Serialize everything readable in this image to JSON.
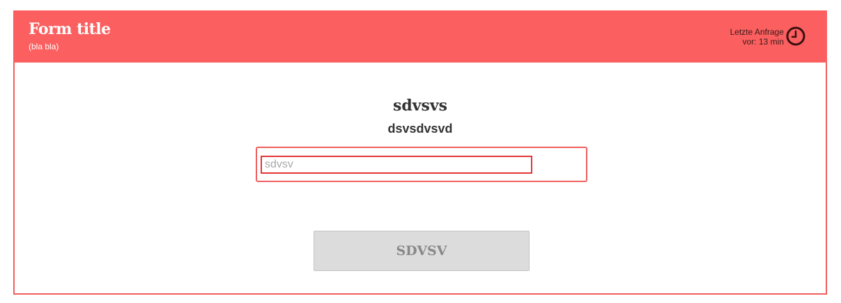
{
  "header": {
    "title": "Form title",
    "subtitle": "(bla bla)",
    "last_request_line1": "Letzte Anfrage",
    "last_request_line2": "vor: 13 min",
    "clock_icon": "clock-icon"
  },
  "question": {
    "title": "sdvsvs",
    "subtitle": "dsvsdvsvd"
  },
  "input": {
    "value": "",
    "placeholder": "sdvsv"
  },
  "submit": {
    "label": "SDVSV"
  },
  "colors": {
    "accent": "#fb5f5f",
    "border": "#f05d5d",
    "input_focus_border": "#e33535",
    "button_bg": "#dcdcdc"
  }
}
